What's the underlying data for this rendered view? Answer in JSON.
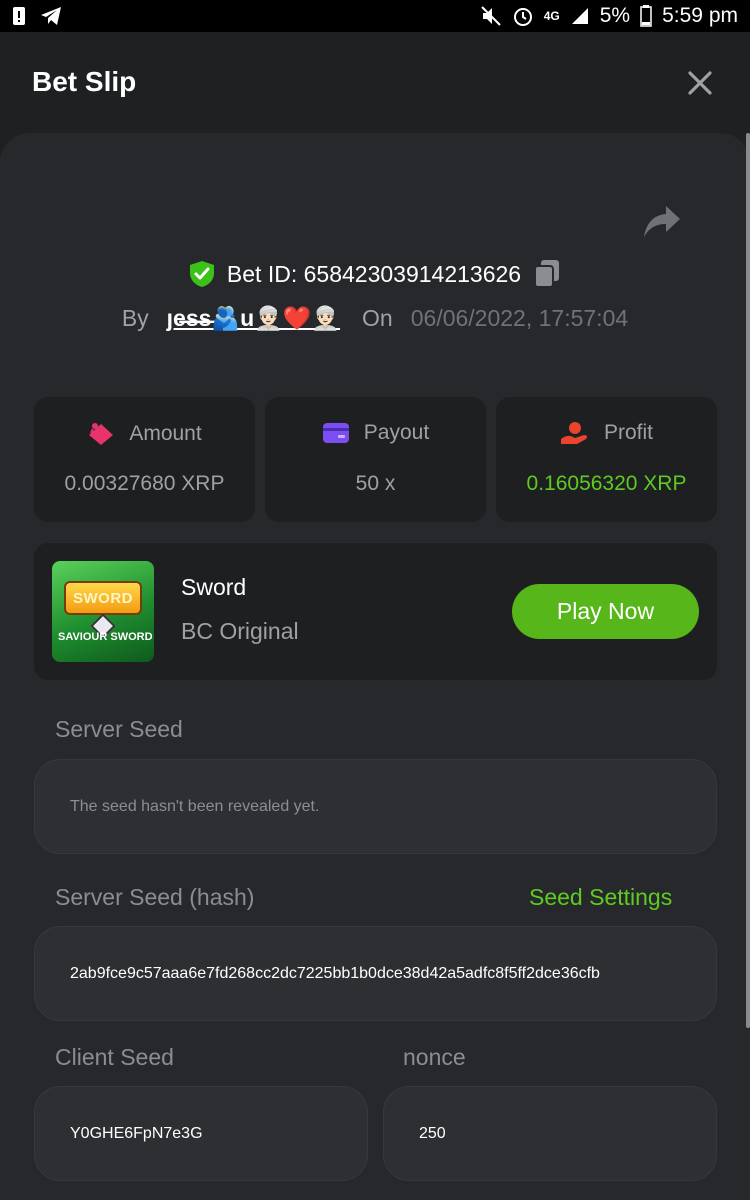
{
  "status_bar": {
    "battery_text": "5%",
    "time": "5:59 pm",
    "network": "4G"
  },
  "header": {
    "title": "Bet Slip"
  },
  "bet": {
    "id_text": "Bet ID: 65842303914213626",
    "by_label": "By",
    "username": "ȷe̶s̶s̶🫂u👳🏻‍♂️❤️👳🏻‍♂️",
    "on_label": "On",
    "date": "06/06/2022, 17:57:04"
  },
  "stats": {
    "amount": {
      "label": "Amount",
      "value": "0.00327680 XRP"
    },
    "payout": {
      "label": "Payout",
      "value": "50 x"
    },
    "profit": {
      "label": "Profit",
      "value": "0.16056320 XRP"
    }
  },
  "game": {
    "name": "Sword",
    "category": "BC Original",
    "play_label": "Play Now",
    "thumb_title": "SWORD",
    "thumb_caption": "SAVIOUR SWORD"
  },
  "seeds": {
    "server_seed_label": "Server Seed",
    "server_seed_value": "The seed hasn't been revealed yet.",
    "server_seed_hash_label": "Server Seed (hash)",
    "seed_settings_label": "Seed Settings",
    "server_seed_hash_value": "2ab9fce9c57aaa6e7fd268cc2dc7225bb1b0dce38d42a5adfc8f5ff2dce36cfb",
    "client_seed_label": "Client Seed",
    "client_seed_value": "Y0GHE6FpN7e3G",
    "nonce_label": "nonce",
    "nonce_value": "250"
  },
  "colors": {
    "accent_green": "#5dcb1f",
    "play_button": "#56b61a",
    "panel": "#27282b",
    "card": "#1e1f21"
  },
  "icons": {
    "share": "share-icon",
    "close": "close-icon",
    "shield": "shield-check-icon",
    "copy": "copy-icon",
    "amount": "amount-icon",
    "payout": "card-icon",
    "profit": "profit-hand-icon"
  }
}
